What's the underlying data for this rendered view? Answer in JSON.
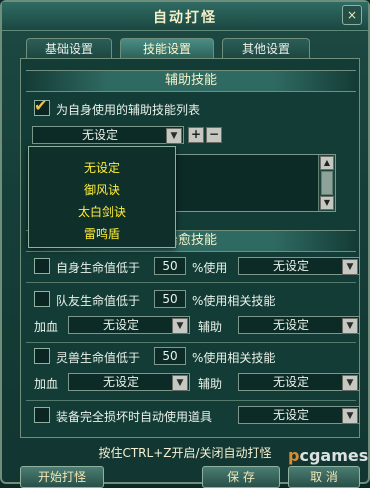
{
  "window": {
    "title": "自动打怪",
    "close_label": "×"
  },
  "tabs": [
    {
      "label": "基础设置"
    },
    {
      "label": "技能设置"
    },
    {
      "label": "其他设置"
    }
  ],
  "assist": {
    "section_title": "辅助技能",
    "checkbox_label": "为自身使用的辅助技能列表",
    "checked": true,
    "selected": "无设定",
    "add_label": "+",
    "remove_label": "−",
    "dropdown_options": [
      "无设定",
      "御风诀",
      "太白剑诀",
      "雷鸣盾"
    ]
  },
  "heal": {
    "section_title": "治愈技能",
    "self_row": {
      "label": "自身生命值低于",
      "value": "50",
      "unit": "%使用",
      "skill": "无设定"
    },
    "ally_row": {
      "label": "队友生命值低于",
      "value": "50",
      "unit": "%使用相关技能"
    },
    "ally_sub": {
      "heal_label": "加血",
      "heal_value": "无设定",
      "assist_label": "辅助",
      "assist_value": "无设定"
    },
    "pet_row": {
      "label": "灵兽生命值低于",
      "value": "50",
      "unit": "%使用相关技能"
    },
    "pet_sub": {
      "heal_label": "加血",
      "heal_value": "无设定",
      "assist_label": "辅助",
      "assist_value": "无设定"
    },
    "equip_row": {
      "label": "装备完全损坏时自动使用道具",
      "value": "无设定"
    }
  },
  "footer": {
    "hint": "按住CTRL+Z开启/关闭自动打怪",
    "start_label": "开始打怪",
    "save_label": "保 存",
    "cancel_label": "取 消"
  },
  "watermark": {
    "brand": "pcgames",
    "accent": "#ff9c2a"
  }
}
